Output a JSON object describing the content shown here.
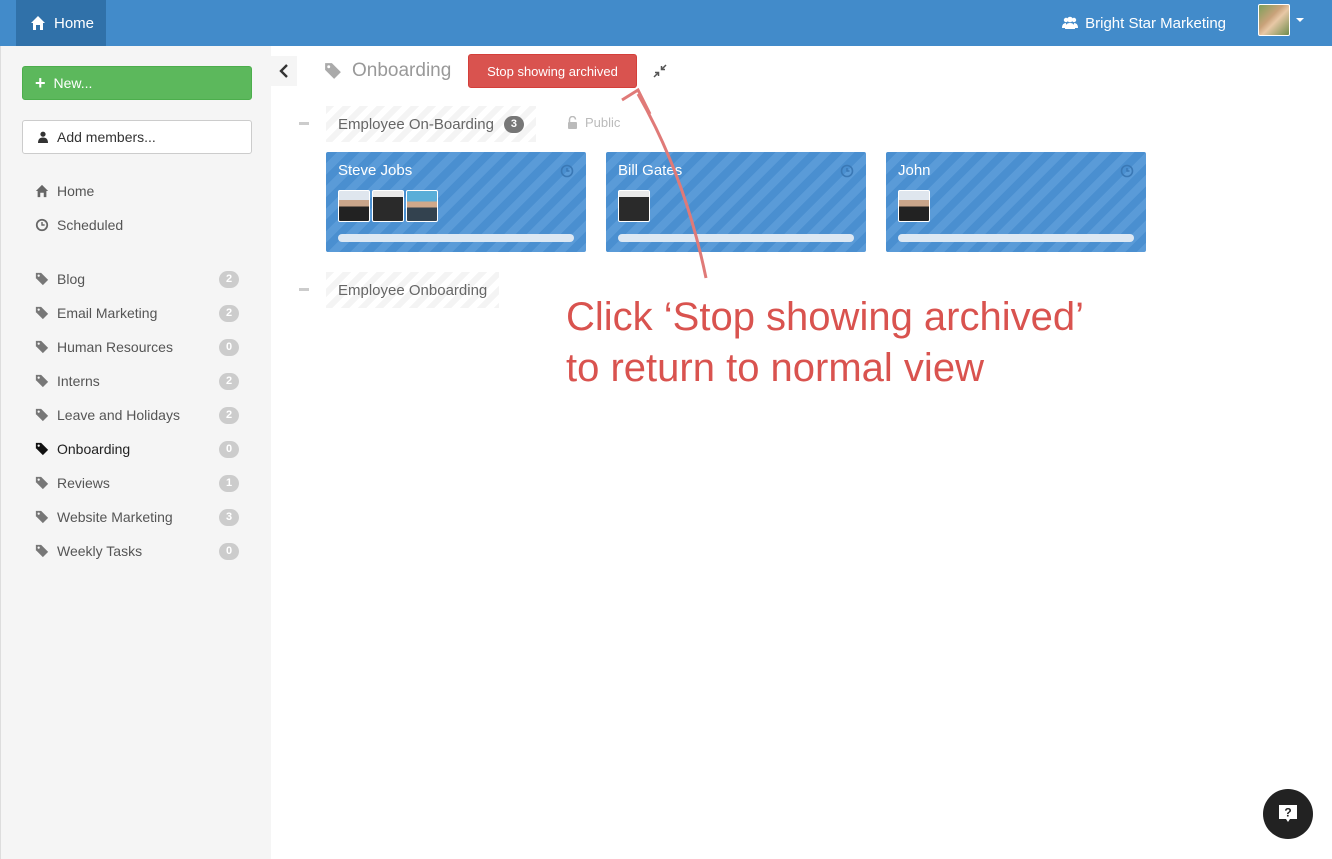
{
  "topbar": {
    "home_label": "Home",
    "org_name": "Bright Star Marketing"
  },
  "sidebar": {
    "new_label": "New...",
    "add_members_label": "Add members...",
    "nav": [
      {
        "label": "Home",
        "icon": "home-icon"
      },
      {
        "label": "Scheduled",
        "icon": "clock-icon"
      }
    ],
    "tags": [
      {
        "label": "Blog",
        "count": "2"
      },
      {
        "label": "Email Marketing",
        "count": "2"
      },
      {
        "label": "Human Resources",
        "count": "0"
      },
      {
        "label": "Interns",
        "count": "2"
      },
      {
        "label": "Leave and Holidays",
        "count": "2"
      },
      {
        "label": "Onboarding",
        "count": "0",
        "active": true
      },
      {
        "label": "Reviews",
        "count": "1"
      },
      {
        "label": "Website Marketing",
        "count": "3"
      },
      {
        "label": "Weekly Tasks",
        "count": "0"
      }
    ]
  },
  "main": {
    "title": "Onboarding",
    "stop_archived_label": "Stop showing archived",
    "groups": [
      {
        "name": "Employee On-Boarding",
        "count": "3",
        "privacy": "Public"
      },
      {
        "name": "Employee Onboarding"
      }
    ],
    "cards": [
      {
        "name": "Steve Jobs",
        "members": 3
      },
      {
        "name": "Bill Gates",
        "members": 1
      },
      {
        "name": "John",
        "members": 1
      }
    ],
    "annotation_line1": "Click ‘Stop showing archived’",
    "annotation_line2": "to return to normal view"
  },
  "colors": {
    "topbar": "#428bca",
    "new_button": "#5cb85c",
    "archived_button": "#d9534f",
    "card": "#4a8fd0",
    "annotation": "#d9534f"
  }
}
